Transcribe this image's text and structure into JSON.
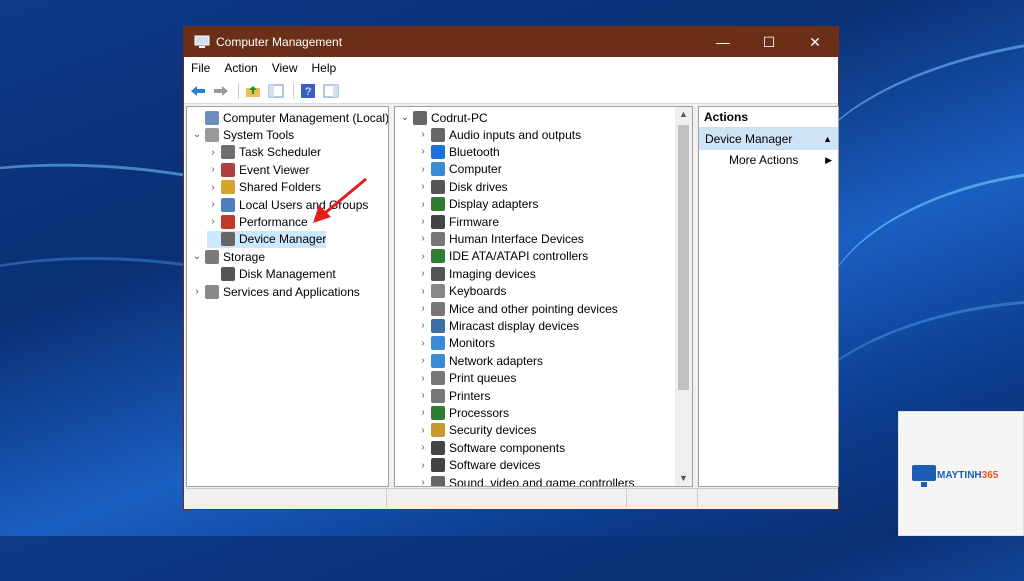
{
  "window": {
    "title": "Computer Management",
    "minimize": "—",
    "maximize": "☐",
    "close": "✕"
  },
  "menu": [
    "File",
    "Action",
    "View",
    "Help"
  ],
  "left_tree": [
    {
      "label": "Computer Management (Local)",
      "arrow": "",
      "icon_color": "#6a8fbf"
    },
    {
      "label": "System Tools",
      "arrow": "⌄",
      "icon_color": "#9a9a9a"
    },
    {
      "label": "Task Scheduler",
      "arrow": "›",
      "icon_color": "#6f6f6f"
    },
    {
      "label": "Event Viewer",
      "arrow": "›",
      "icon_color": "#b04040"
    },
    {
      "label": "Shared Folders",
      "arrow": "›",
      "icon_color": "#d4a52c"
    },
    {
      "label": "Local Users and Groups",
      "arrow": "›",
      "icon_color": "#4f7fbf"
    },
    {
      "label": "Performance",
      "arrow": "›",
      "icon_color": "#c0392b"
    },
    {
      "label": "Device Manager",
      "arrow": "",
      "icon_color": "#666666"
    },
    {
      "label": "Storage",
      "arrow": "⌄",
      "icon_color": "#7a7a7a"
    },
    {
      "label": "Disk Management",
      "arrow": "",
      "icon_color": "#555555"
    },
    {
      "label": "Services and Applications",
      "arrow": "›",
      "icon_color": "#8a8a8a"
    }
  ],
  "device_tree": {
    "root": "Codrut-PC",
    "items": [
      {
        "label": "Audio inputs and outputs",
        "icon_color": "#666666"
      },
      {
        "label": "Bluetooth",
        "icon_color": "#1e6fd9"
      },
      {
        "label": "Computer",
        "icon_color": "#3a8ad8"
      },
      {
        "label": "Disk drives",
        "icon_color": "#555555"
      },
      {
        "label": "Display adapters",
        "icon_color": "#2e7d32"
      },
      {
        "label": "Firmware",
        "icon_color": "#444444"
      },
      {
        "label": "Human Interface Devices",
        "icon_color": "#777777"
      },
      {
        "label": "IDE ATA/ATAPI controllers",
        "icon_color": "#2e7d32"
      },
      {
        "label": "Imaging devices",
        "icon_color": "#555555"
      },
      {
        "label": "Keyboards",
        "icon_color": "#888888"
      },
      {
        "label": "Mice and other pointing devices",
        "icon_color": "#777777"
      },
      {
        "label": "Miracast display devices",
        "icon_color": "#3a6ea5"
      },
      {
        "label": "Monitors",
        "icon_color": "#3a8ad8"
      },
      {
        "label": "Network adapters",
        "icon_color": "#3a8ad8"
      },
      {
        "label": "Print queues",
        "icon_color": "#777777"
      },
      {
        "label": "Printers",
        "icon_color": "#777777"
      },
      {
        "label": "Processors",
        "icon_color": "#2e7d32"
      },
      {
        "label": "Security devices",
        "icon_color": "#c79a2c"
      },
      {
        "label": "Software components",
        "icon_color": "#444444"
      },
      {
        "label": "Software devices",
        "icon_color": "#444444"
      },
      {
        "label": "Sound, video and game controllers",
        "icon_color": "#666666"
      }
    ]
  },
  "actions": {
    "header": "Actions",
    "selected": "Device Manager",
    "more": "More Actions"
  },
  "logo": {
    "brand_a": "MAYTINH",
    "brand_b": "365"
  }
}
